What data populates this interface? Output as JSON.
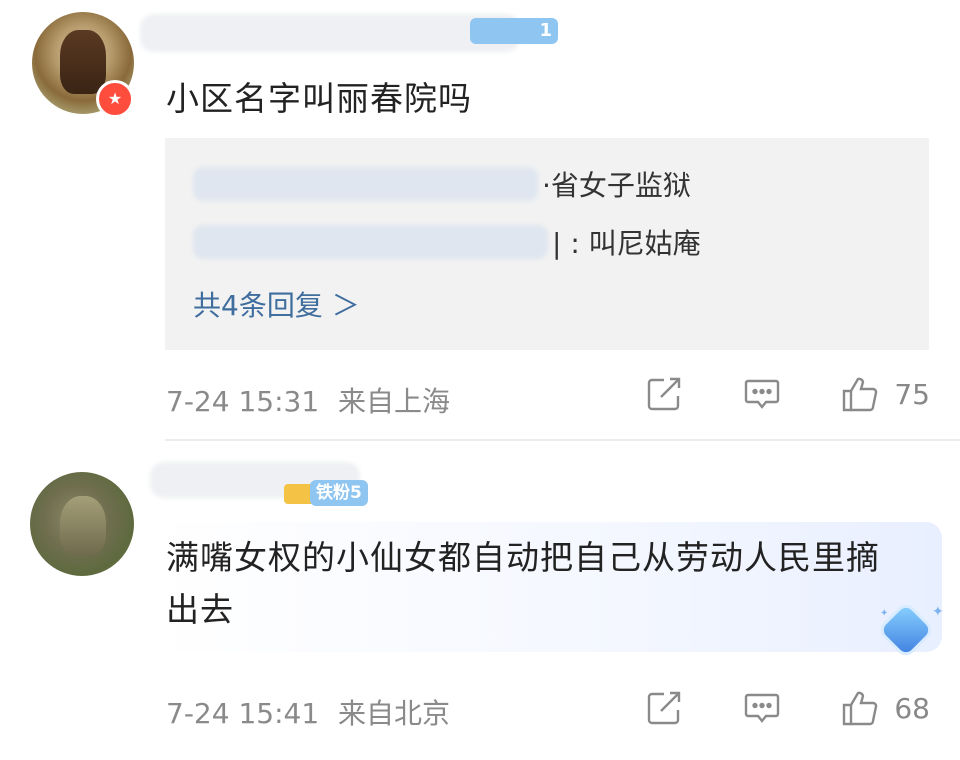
{
  "comments": [
    {
      "text": "小区名字叫丽春院吗",
      "level_badge": "1",
      "replies": [
        {
          "text": "·省女子监狱"
        },
        {
          "text": "| : 叫尼姑庵"
        }
      ],
      "more_replies": "共4条回复 ＞",
      "time": "7-24 15:31",
      "location": "来自上海",
      "likes": "75"
    },
    {
      "text": "满嘴女权的小仙女都自动把自己从劳动人民里摘出去",
      "fan_badge": "铁粉5",
      "time": "7-24 15:41",
      "location": "来自北京",
      "likes": "68"
    }
  ],
  "icons": {
    "share": "share-icon",
    "comment": "comment-icon",
    "like": "thumbs-up-icon"
  }
}
